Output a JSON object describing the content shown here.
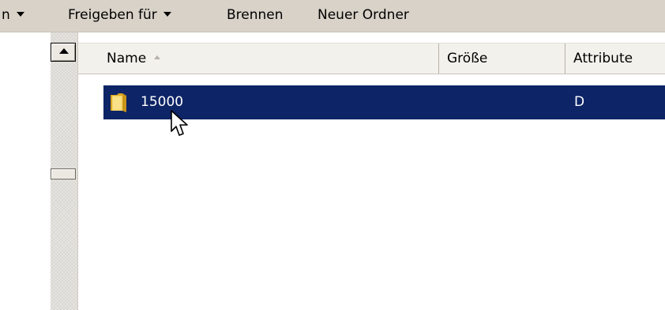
{
  "toolbar": {
    "partial_label": "n",
    "share_label": "Freigeben für",
    "burn_label": "Brennen",
    "new_folder_label": "Neuer Ordner"
  },
  "columns": {
    "name": "Name",
    "size": "Größe",
    "attributes": "Attribute",
    "sort_icon": "sort-ascending-icon"
  },
  "rows": [
    {
      "name": "15000",
      "size": "",
      "attributes": "D",
      "icon": "folder-icon",
      "selected": true
    }
  ],
  "colors": {
    "toolbar_bg": "#d8d2c8",
    "selection": "#0d2466",
    "header_bg": "#f3f1ec"
  }
}
